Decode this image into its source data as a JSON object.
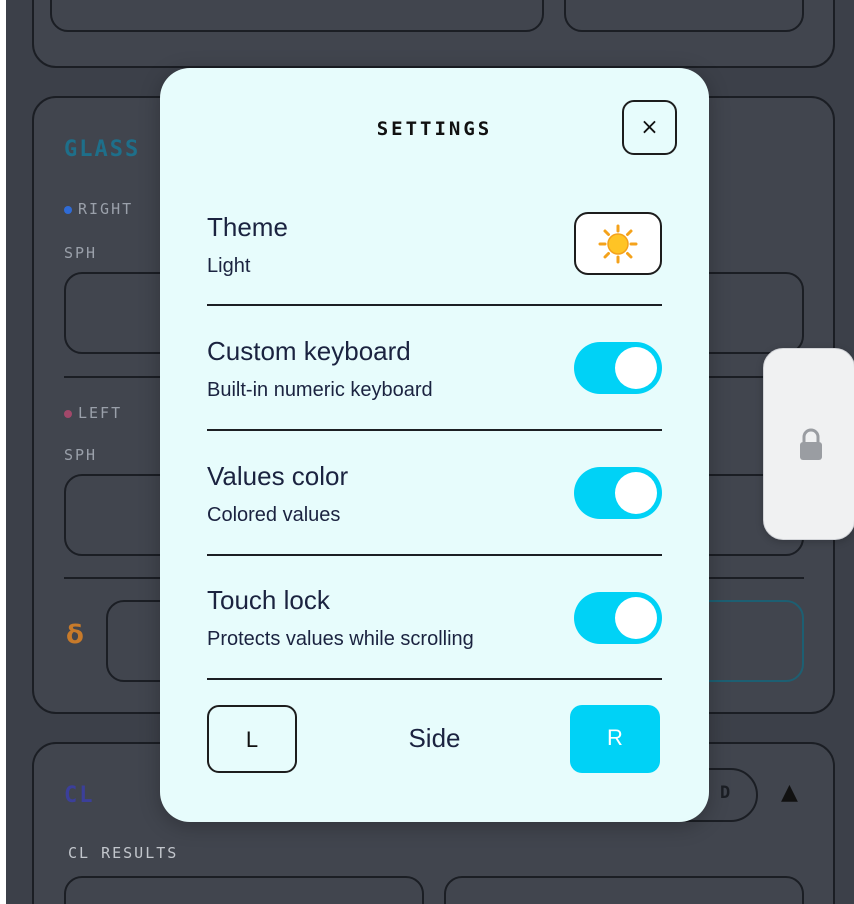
{
  "background": {
    "glass_title": "GLASS",
    "right_label": "RIGHT",
    "left_label": "LEFT",
    "sph_label": "SPH",
    "delta_symbol": "δ",
    "cl_title": "CL",
    "cl_badge": "D",
    "cl_results_label": "CL RESULTS",
    "collapse_symbol": "▲",
    "colors": {
      "right_dot": "#2f6bd6",
      "left_dot": "#a2486a",
      "delta": "#c77a2a"
    }
  },
  "settings": {
    "title": "SETTINGS",
    "close_symbol": "×",
    "theme": {
      "title": "Theme",
      "subtitle": "Light",
      "icon": "sun-icon"
    },
    "custom_keyboard": {
      "title": "Custom keyboard",
      "subtitle": "Built-in numeric keyboard",
      "enabled": true
    },
    "values_color": {
      "title": "Values color",
      "subtitle": "Colored values",
      "enabled": true
    },
    "touch_lock": {
      "title": "Touch lock",
      "subtitle": "Protects values while scrolling",
      "enabled": true
    },
    "side": {
      "label": "Side",
      "left": "L",
      "right": "R",
      "selected": "R"
    }
  },
  "lock_pad": {
    "icon": "lock-icon"
  },
  "colors": {
    "accent": "#00d2f6",
    "modal_bg": "#e7fcfc",
    "text": "#1b2340",
    "backdrop": "#3c4049"
  }
}
